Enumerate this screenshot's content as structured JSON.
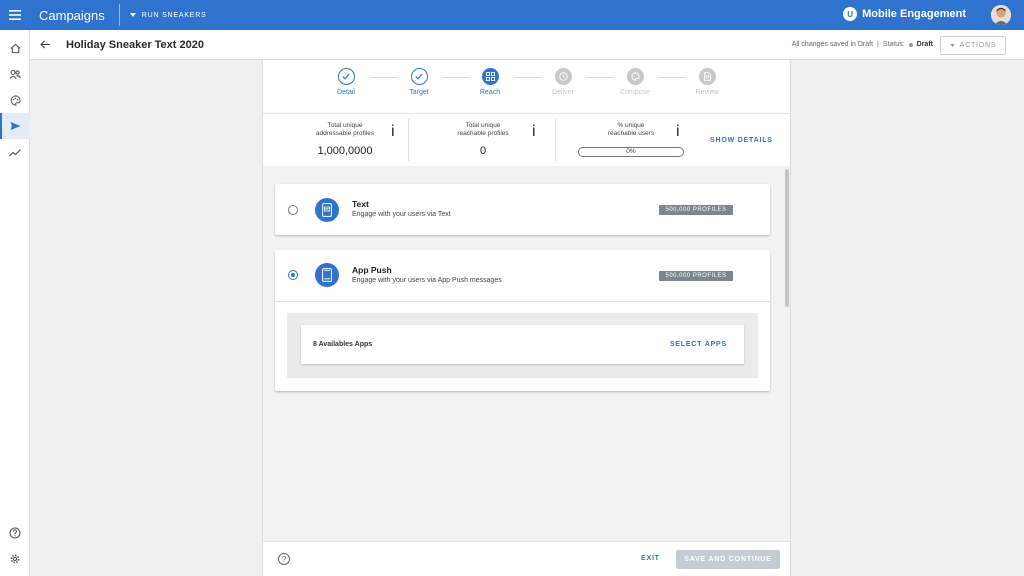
{
  "topbar": {
    "app_title": "Campaigns",
    "project": "RUN SNEAKERS",
    "brand_name": "Mobile Engagement",
    "brand_letter": "U"
  },
  "subheader": {
    "title": "Holiday Sneaker Text 2020",
    "saved_text": "All changes saved in Draft",
    "separator": "|",
    "status_label": "Status:",
    "status_value": "Draft",
    "actions_label": "ACTIONS"
  },
  "stepper": {
    "steps": [
      {
        "label": "Detail",
        "state": "done"
      },
      {
        "label": "Target",
        "state": "done"
      },
      {
        "label": "Reach",
        "state": "current"
      },
      {
        "label": "Deliver",
        "state": "future"
      },
      {
        "label": "Compose",
        "state": "future"
      },
      {
        "label": "Review",
        "state": "future"
      }
    ]
  },
  "stats": {
    "addressable": {
      "label": "Total unique\naddressable profiles",
      "value": "1,000,0000"
    },
    "reachable": {
      "label": "Total unique\nreachable profiles",
      "value": "0"
    },
    "percent": {
      "label": "% unique\nreachable users",
      "value": "0%",
      "fraction": 0
    },
    "info_glyph": "i",
    "show_details": "SHOW DETAILS"
  },
  "channels": [
    {
      "title": "Text",
      "description": "Engage with your users via Text",
      "badge": "500,000 PROFILES",
      "selected": false
    },
    {
      "title": "App Push",
      "description": "Engage with your users via App Push messages",
      "badge": "500,000 PROFILES",
      "selected": true
    }
  ],
  "apps": {
    "count_text": "8 Availables Apps",
    "select_label": "SELECT APPS"
  },
  "footer": {
    "help_glyph": "?",
    "exit_label": "EXIT",
    "save_label": "SAVE AND CONTINUE"
  },
  "colors": {
    "primary": "#2f73cf",
    "badge": "#7d8590",
    "disabled_button": "#c7cbd3"
  }
}
